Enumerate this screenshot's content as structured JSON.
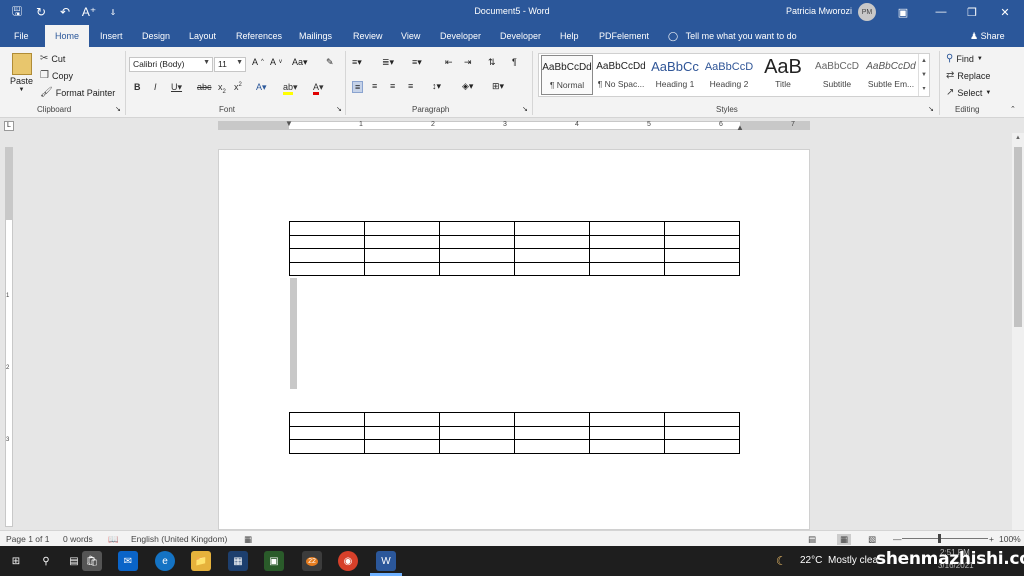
{
  "titlebar": {
    "doc_title": "Document5 - Word",
    "user_name": "Patricia Mworozi",
    "user_initials": "PM",
    "bg_color": "#2b579a"
  },
  "tabs": [
    "File",
    "Home",
    "Insert",
    "Design",
    "Layout",
    "References",
    "Mailings",
    "Review",
    "View",
    "Developer",
    "Developer",
    "Help",
    "PDFelement"
  ],
  "active_tab": "Home",
  "tell_me": "Tell me what you want to do",
  "share": "Share",
  "clipboard": {
    "paste": "Paste",
    "cut": "Cut",
    "copy": "Copy",
    "format_painter": "Format Painter",
    "label": "Clipboard"
  },
  "font": {
    "name": "Calibri (Body)",
    "size": "11",
    "label": "Font"
  },
  "paragraph": {
    "label": "Paragraph"
  },
  "styles": {
    "label": "Styles",
    "items": [
      {
        "sample": "AaBbCcDd",
        "name": "¶ Normal"
      },
      {
        "sample": "AaBbCcDd",
        "name": "¶ No Spac..."
      },
      {
        "sample": "AaBbCc",
        "name": "Heading 1"
      },
      {
        "sample": "AaBbCcD",
        "name": "Heading 2"
      },
      {
        "sample": "AaB",
        "name": "Title"
      },
      {
        "sample": "AaBbCcD",
        "name": "Subtitle"
      },
      {
        "sample": "AaBbCcDd",
        "name": "Subtle Em..."
      }
    ]
  },
  "editing": {
    "find": "Find",
    "replace": "Replace",
    "select": "Select",
    "label": "Editing"
  },
  "ruler": {
    "numbers": [
      "1",
      "2",
      "3",
      "4",
      "5",
      "6",
      "7"
    ],
    "v_numbers": [
      "1",
      "2",
      "3"
    ]
  },
  "document": {
    "table1_rows": 4,
    "table2_rows": 3,
    "columns": 6
  },
  "status": {
    "page": "Page 1 of 1",
    "words": "0 words",
    "language": "English (United Kingdom)",
    "zoom": "100%"
  },
  "taskbar": {
    "badge": "22",
    "temperature": "22°C",
    "weather": "Mostly clea",
    "time": "2:51 PM",
    "date": "3/16/2021"
  },
  "watermark": "shenmazhishi.com"
}
